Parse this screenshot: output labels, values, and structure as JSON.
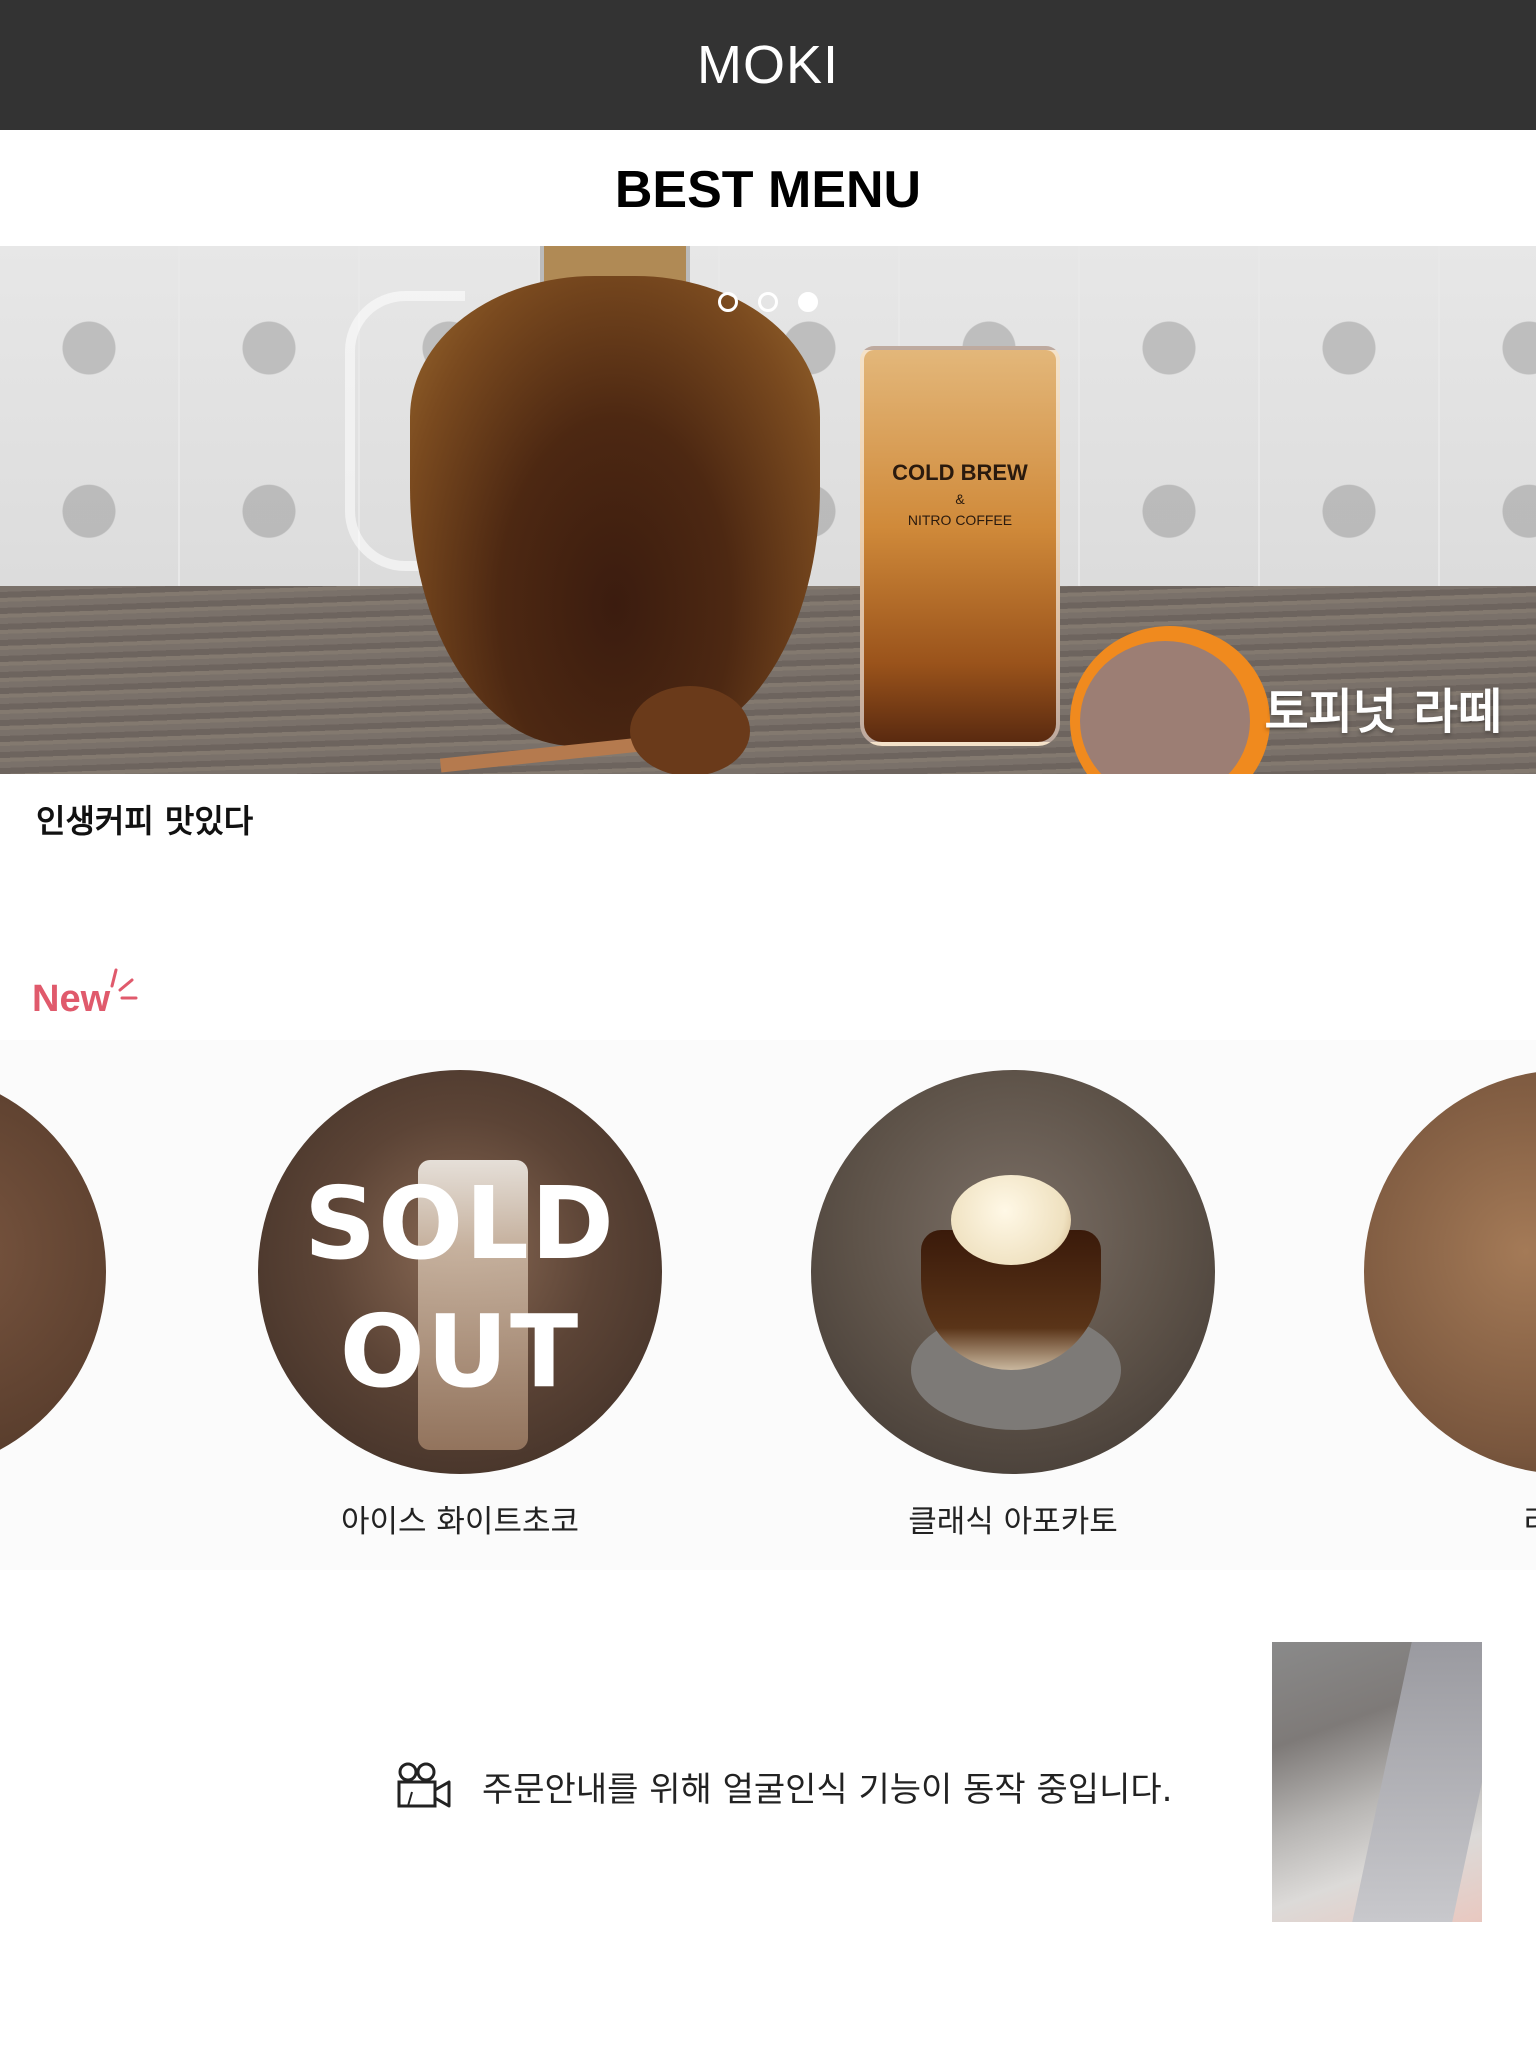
{
  "header": {
    "app_title": "MOKI"
  },
  "best_menu": {
    "title": "BEST MENU",
    "carousel_dots": 3,
    "active_dot": 3,
    "slide": {
      "caption": "토피넛 라떼",
      "description": "인생커피 맛있다",
      "image_text": {
        "line1": "COLD BREW",
        "line2": "&",
        "line3": "NITRO COFFEE"
      }
    }
  },
  "new_section": {
    "label": "New",
    "items": [
      {
        "name": "",
        "sold_out": false
      },
      {
        "name": "아이스 화이트초코",
        "sold_out": true,
        "sold_out_line1": "SOLD",
        "sold_out_line2": "OUT"
      },
      {
        "name": "클래식 아포카토",
        "sold_out": false
      },
      {
        "name": "리스트",
        "sold_out": false
      }
    ]
  },
  "face_recognition": {
    "notice": "주문안내를 위해 얼굴인식 기능이 동작 중입니다.",
    "icon": "video-camera-icon"
  },
  "colors": {
    "topbar": "#333333",
    "new_accent": "#e05a6c",
    "carousel_bg": "#fbfbfb"
  }
}
